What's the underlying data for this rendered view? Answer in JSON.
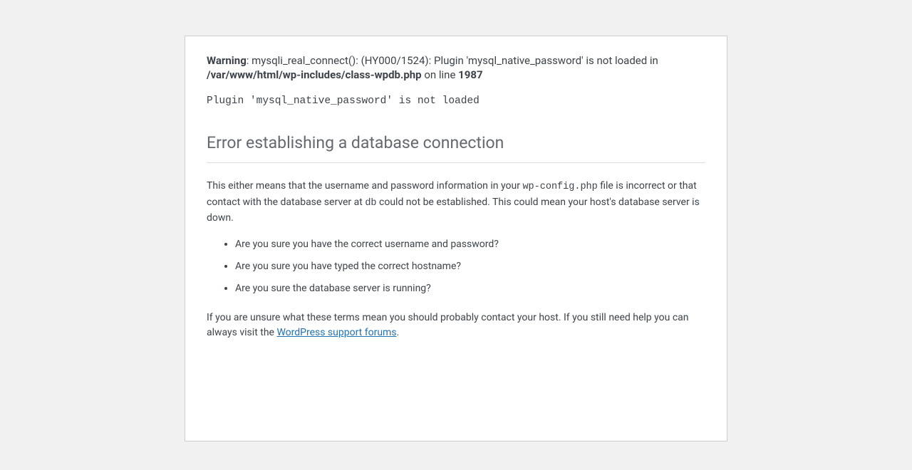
{
  "phpWarning": {
    "label": "Warning",
    "sep": ": ",
    "message": "mysqli_real_connect(): (HY000/1524): Plugin 'mysql_native_password' is not loaded in ",
    "filePath": "/var/www/html/wp-includes/class-wpdb.php",
    "onLine": " on line ",
    "lineNumber": "1987"
  },
  "wpDbError": "Plugin 'mysql_native_password' is not loaded",
  "heading": "Error establishing a database connection",
  "body": {
    "p1a": "This either means that the username and password information in your ",
    "p1code1": "wp-config.php",
    "p1b": " file is incorrect or that contact with the database server at ",
    "p1code2": "db",
    "p1c": " could not be established. This could mean your host's database server is down."
  },
  "bullets": {
    "b1": "Are you sure you have the correct username and password?",
    "b2": "Are you sure you have typed the correct hostname?",
    "b3": "Are you sure the database server is running?"
  },
  "footer": {
    "t1": "If you are unsure what these terms mean you should probably contact your host. If you still need help you can always visit the ",
    "linkText": "WordPress support forums",
    "t2": "."
  }
}
